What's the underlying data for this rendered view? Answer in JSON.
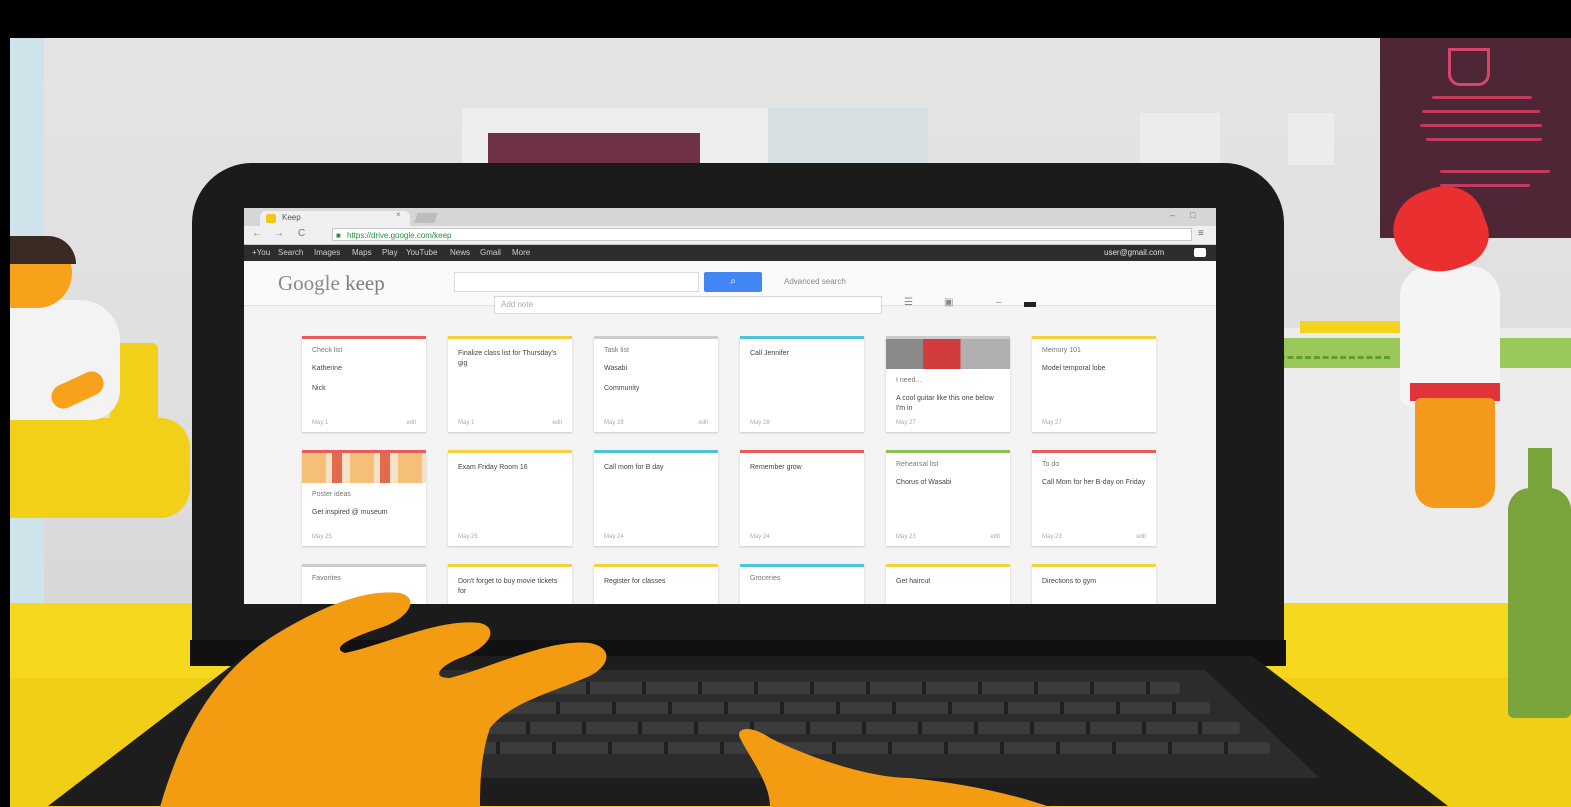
{
  "browser": {
    "tab_title": "Keep",
    "tab_close": "×",
    "window_controls": [
      "–",
      "□"
    ],
    "nav": [
      "←",
      "→",
      "C"
    ],
    "url": "https://drive.google.com/keep",
    "menu_icon": "≡"
  },
  "google_bar": {
    "items": [
      "+You",
      "Search",
      "Images",
      "Maps",
      "Play",
      "YouTube",
      "News",
      "Gmail",
      "More"
    ],
    "user": "user@gmail.com"
  },
  "keep": {
    "logo_brand": "Google",
    "logo_product": " keep",
    "search_button_icon": "search-icon",
    "search_hint": "Advanced search",
    "add_note_placeholder": "Add note",
    "tool_list": "list-icon",
    "tool_image": "image-icon",
    "view_toggle": "grid-view-icon"
  },
  "accent_colors": {
    "red": "#e85c5c",
    "yellow": "#f5d23c",
    "gray": "#cccccc",
    "teal": "#4fc3d9",
    "green": "#8cc152"
  },
  "notes": [
    {
      "title": "Check list",
      "body": "Katherine\n\nNick",
      "footer": "May 1",
      "footer_right": "edit",
      "accent": "red"
    },
    {
      "title": "",
      "body": "Finalize class list for Thursday's gig",
      "footer": "May 1",
      "footer_right": "edit",
      "accent": "yellow"
    },
    {
      "title": "Task list",
      "body": "Wasabi\n\nCommunity",
      "footer": "May 28",
      "footer_right": "edit",
      "accent": "gray"
    },
    {
      "title": "",
      "body": "Call Jennifer",
      "footer": "May 28",
      "footer_right": "",
      "accent": "teal"
    },
    {
      "title": "I need...",
      "body": "A cool guitar like this one below I'm in",
      "footer": "May 27",
      "footer_right": "",
      "accent": "gray",
      "image": true
    },
    {
      "title": "Memory 101",
      "body": "Model temporal lobe",
      "footer": "May 27",
      "footer_right": "",
      "accent": "yellow"
    },
    {
      "title": "Poster ideas",
      "body": "Get inspired @ museum",
      "footer": "May 25",
      "footer_right": "",
      "accent": "red",
      "image": true
    },
    {
      "title": "",
      "body": "Exam Friday Room 16",
      "footer": "May 25",
      "footer_right": "",
      "accent": "yellow"
    },
    {
      "title": "",
      "body": "Call mom for B day",
      "footer": "May 24",
      "footer_right": "",
      "accent": "teal"
    },
    {
      "title": "",
      "body": "Remember grow",
      "footer": "May 24",
      "footer_right": "",
      "accent": "red"
    },
    {
      "title": "Rehearsal list",
      "body": "Chorus of Wasabi",
      "footer": "May 23",
      "footer_right": "edit",
      "accent": "green"
    },
    {
      "title": "To do",
      "body": "Call Mom for her B-day on Friday",
      "footer": "May 23",
      "footer_right": "edit",
      "accent": "red"
    },
    {
      "title": "Favorites",
      "body": "",
      "footer": "",
      "footer_right": "",
      "accent": "gray"
    },
    {
      "title": "",
      "body": "Don't forget to buy movie tickets for",
      "footer": "",
      "footer_right": "",
      "accent": "yellow"
    },
    {
      "title": "",
      "body": "Register for classes",
      "footer": "",
      "footer_right": "",
      "accent": "yellow"
    },
    {
      "title": "Groceries",
      "body": "",
      "footer": "",
      "footer_right": "",
      "accent": "teal"
    },
    {
      "title": "",
      "body": "Get haircut",
      "footer": "",
      "footer_right": "",
      "accent": "yellow"
    },
    {
      "title": "",
      "body": "Directions to gym",
      "footer": "",
      "footer_right": "",
      "accent": "yellow"
    }
  ]
}
